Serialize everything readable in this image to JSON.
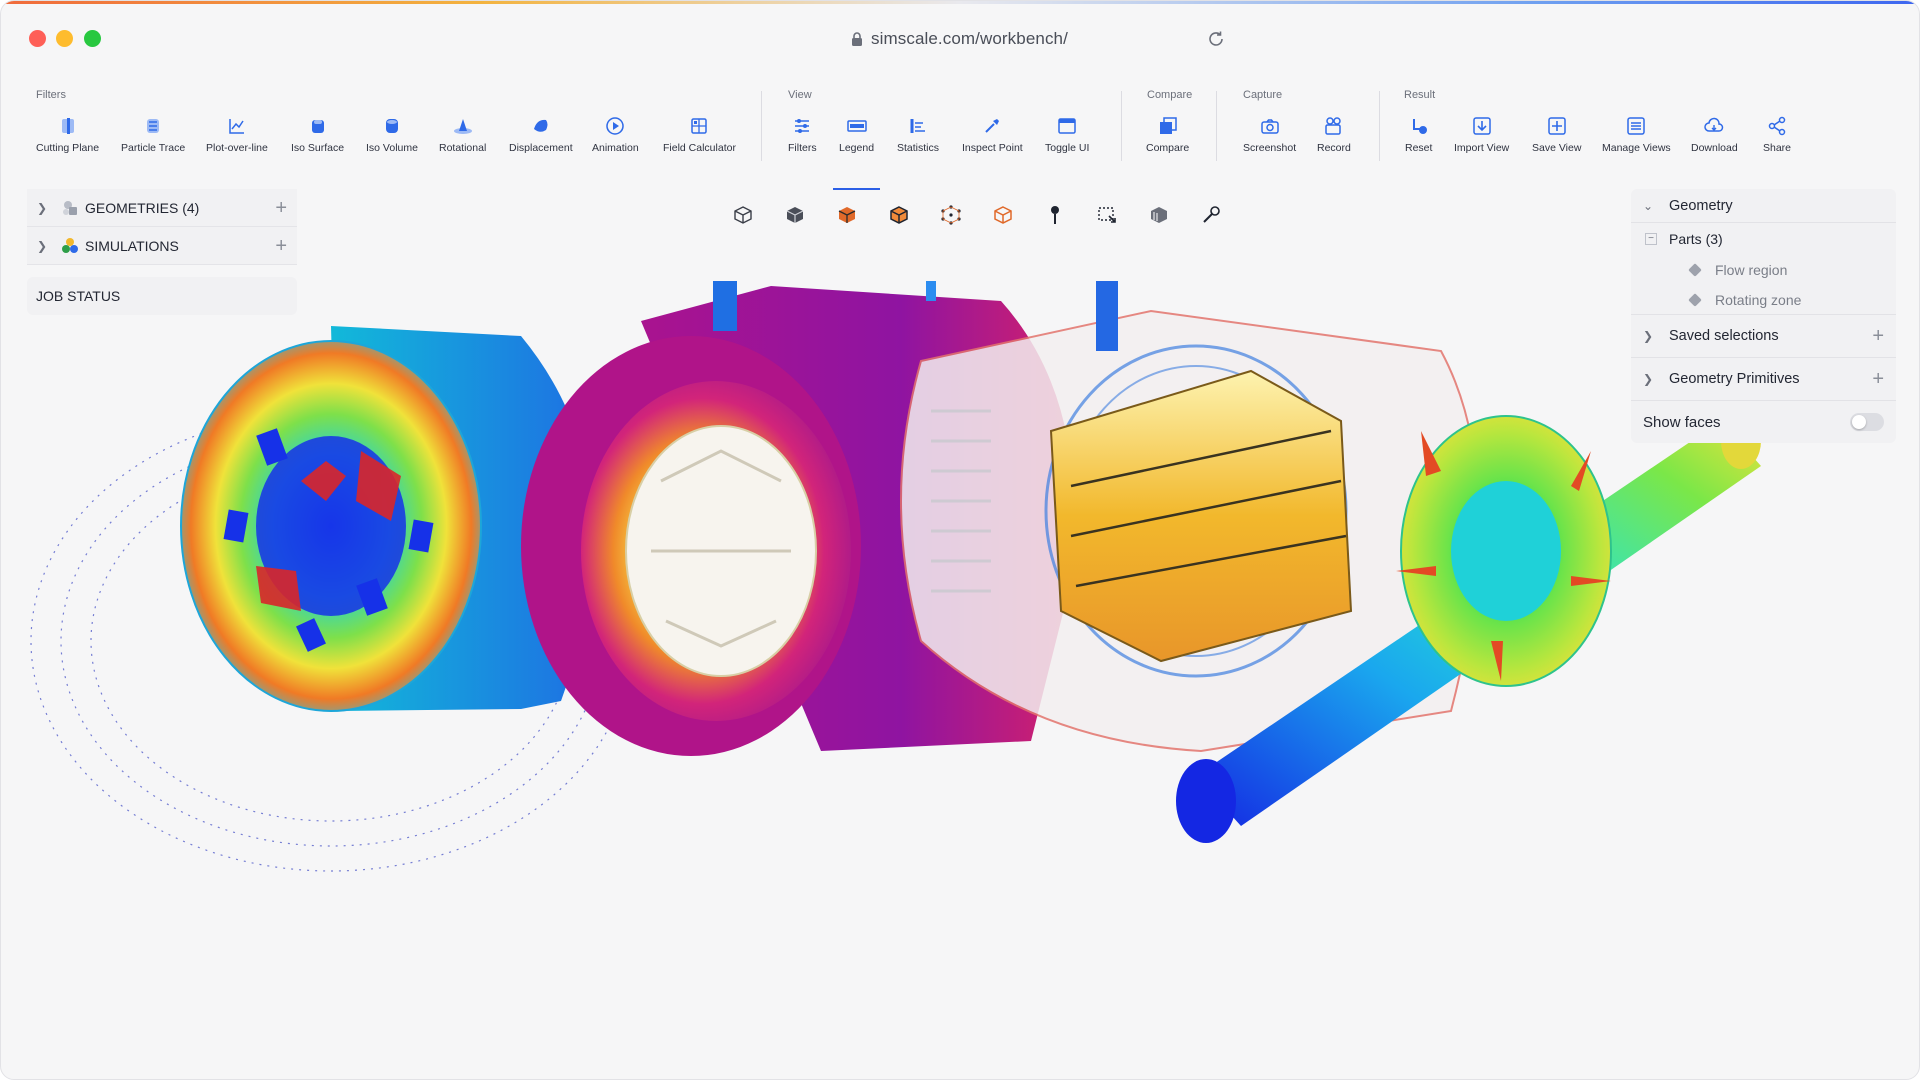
{
  "browser": {
    "url": "simscale.com/workbench/"
  },
  "toolbar": {
    "groups": {
      "filters": "Filters",
      "view": "View",
      "compare": "Compare",
      "capture": "Capture",
      "result": "Result"
    },
    "tools": {
      "cutting_plane": "Cutting Plane",
      "particle_trace": "Particle Trace",
      "plot_over_line": "Plot-over-line",
      "iso_surface": "Iso Surface",
      "iso_volume": "Iso Volume",
      "rotational": "Rotational",
      "displacement": "Displacement",
      "animation": "Animation",
      "field_calculator": "Field Calculator",
      "filters": "Filters",
      "legend": "Legend",
      "statistics": "Statistics",
      "inspect_point": "Inspect Point",
      "toggle_ui": "Toggle UI",
      "compare": "Compare",
      "screenshot": "Screenshot",
      "record": "Record",
      "reset": "Reset",
      "import_view": "Import View",
      "save_view": "Save View",
      "manage_views": "Manage Views",
      "download": "Download",
      "share": "Share"
    },
    "active_tool": "Legend",
    "accent_color": "#2b5fe6",
    "icon_color": "#2f6ae8"
  },
  "left_panel": {
    "geometries": "GEOMETRIES (4)",
    "simulations": "SIMULATIONS",
    "job_status": "JOB STATUS"
  },
  "right_panel": {
    "geometry": "Geometry",
    "parts": "Parts (3)",
    "part_items": [
      "Flow region",
      "Rotating zone"
    ],
    "saved_selections": "Saved selections",
    "geometry_primitives": "Geometry Primitives",
    "show_faces": "Show faces",
    "show_faces_on": false
  },
  "view_tools": [
    "cube-wireframe-icon",
    "cube-solid-icon",
    "cube-orange-icon",
    "cube-edges-icon",
    "cube-points-icon",
    "cube-outline-icon",
    "pin-icon",
    "box-select-icon",
    "layers-icon",
    "probe-icon"
  ]
}
